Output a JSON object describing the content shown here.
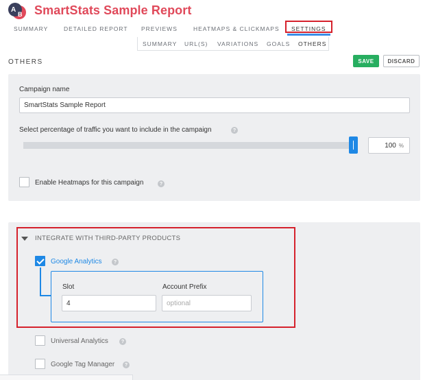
{
  "app": {
    "title": "SmartStats Sample Report",
    "logo_text": "AB"
  },
  "main_nav": {
    "items": [
      {
        "label": "SUMMARY"
      },
      {
        "label": "DETAILED REPORT"
      },
      {
        "label": "PREVIEWS"
      },
      {
        "label": "HEATMAPS & CLICKMAPS"
      },
      {
        "label": "SETTINGS",
        "active": true
      }
    ]
  },
  "sub_nav": {
    "items": [
      {
        "label": "SUMMARY"
      },
      {
        "label": "URL(S)"
      },
      {
        "label": "VARIATIONS"
      },
      {
        "label": "GOALS"
      },
      {
        "label": "OTHERS",
        "active": true
      }
    ]
  },
  "section": {
    "heading": "OTHERS",
    "save_label": "SAVE",
    "discard_label": "DISCARD"
  },
  "campaign": {
    "name_label": "Campaign name",
    "name_value": "SmartStats Sample Report",
    "traffic_label": "Select percentage of traffic you want to include in the campaign",
    "traffic_value": "100",
    "traffic_unit": "%",
    "traffic_level": 1.0,
    "heatmaps_label": "Enable Heatmaps for this campaign",
    "heatmaps_checked": false
  },
  "integrations": {
    "heading": "INTEGRATE WITH THIRD-PARTY PRODUCTS",
    "google_analytics": {
      "label": "Google Analytics",
      "checked": true,
      "slot_label": "Slot",
      "slot_value": "4",
      "prefix_label": "Account Prefix",
      "prefix_placeholder": "optional"
    },
    "universal_analytics": {
      "label": "Universal Analytics",
      "checked": false
    },
    "google_tag_manager": {
      "label": "Google Tag Manager",
      "checked": false
    }
  },
  "icons": {
    "help": "help-icon",
    "check": "check-icon",
    "collapse": "triangle-down-icon"
  },
  "colors": {
    "brand": "#e0495a",
    "accent": "#1e88e5",
    "save": "#27ae60",
    "highlight": "#d5202b"
  }
}
